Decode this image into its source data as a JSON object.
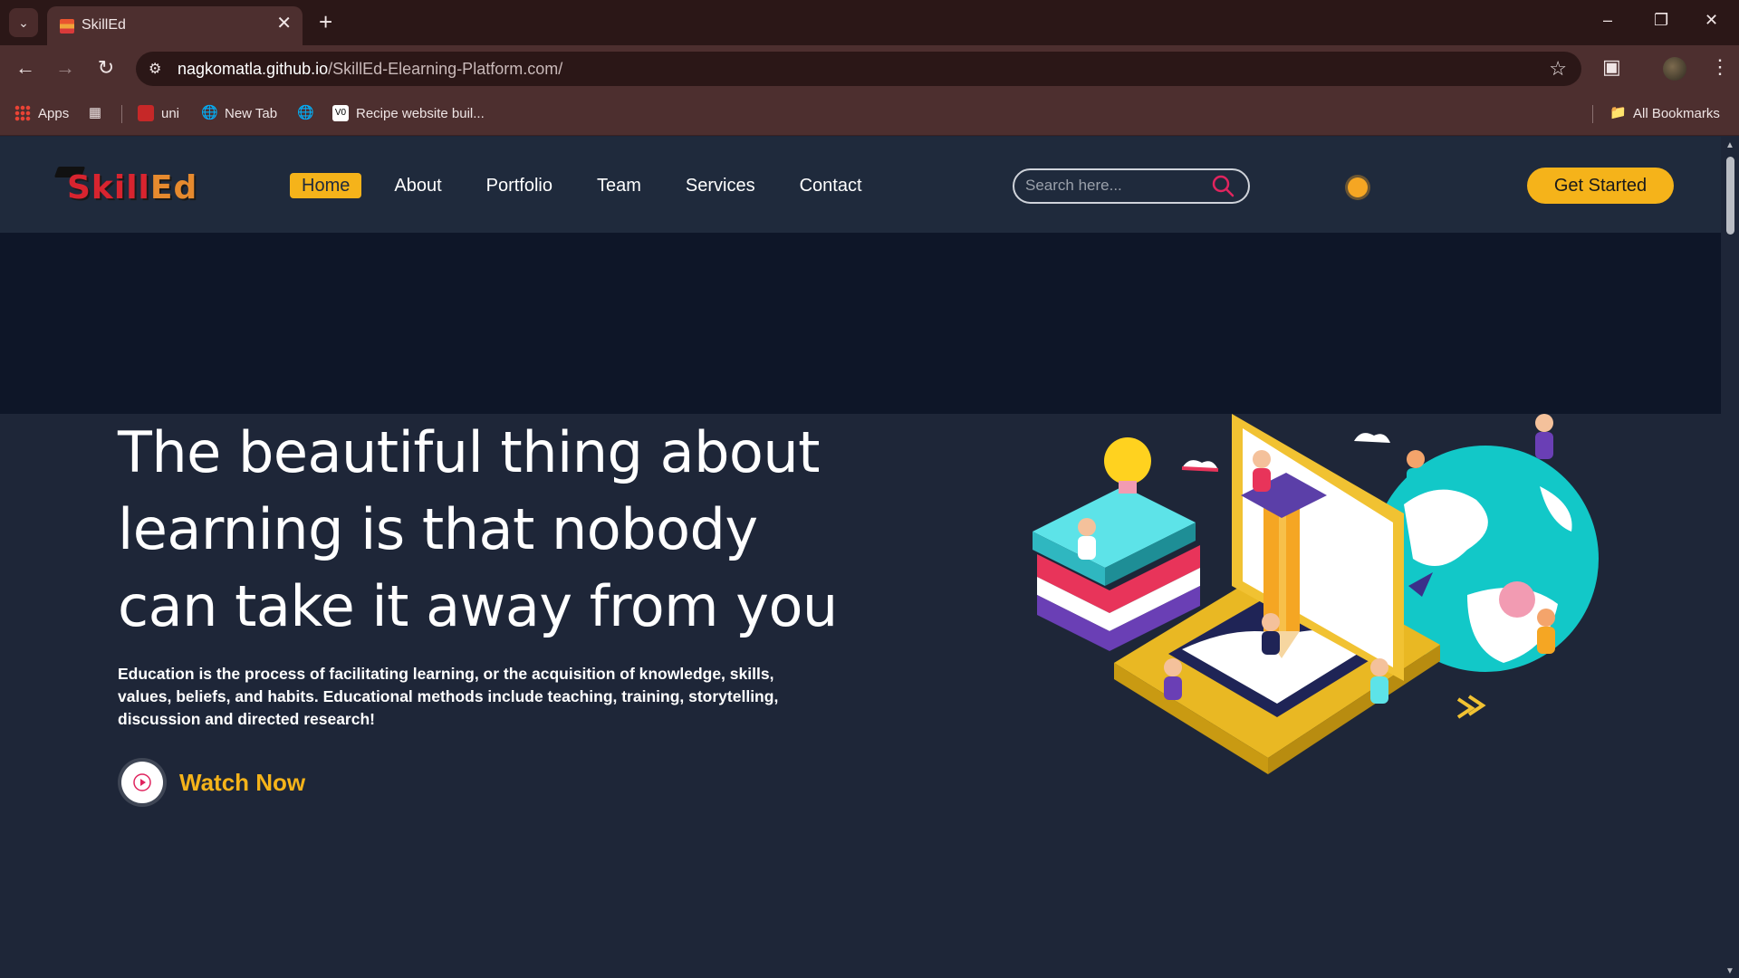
{
  "browser": {
    "tab_title": "SkillEd",
    "url_host": "nagkomatla.github.io",
    "url_path": "/SkillEd-Elearning-Platform.com/",
    "bookmarks": {
      "apps": "Apps",
      "uni": "uni",
      "new_tab": "New Tab",
      "recipe": "Recipe website buil...",
      "all_bookmarks": "All Bookmarks"
    }
  },
  "site": {
    "logo": {
      "main": "Skill",
      "accent": "Ed"
    },
    "nav": [
      "Home",
      "About",
      "Portfolio",
      "Team",
      "Services",
      "Contact"
    ],
    "active_nav": "Home",
    "search_placeholder": "Search here...",
    "cta_label": "Get Started"
  },
  "hero": {
    "title": "The beautiful thing about learning is that nobody can take it away from you",
    "description": "Education is the process of facilitating learning, or the acquisition of knowledge, skills, values, beliefs, and habits. Educational methods include teaching, training, storytelling, discussion and directed research!",
    "watch_label": "Watch Now"
  },
  "colors": {
    "accent": "#f5b31a",
    "header_bg": "#1f2a3c",
    "band_bg": "#0e1628",
    "page_bg": "#1e2638",
    "chrome_bg": "#4d2f2f"
  },
  "icons": [
    "tab-list-icon",
    "close-icon",
    "plus-icon",
    "back-icon",
    "forward-icon",
    "reload-icon",
    "site-info-icon",
    "star-icon",
    "extensions-icon",
    "menu-icon",
    "search-icon",
    "play-icon",
    "sun-icon",
    "folder-icon"
  ]
}
